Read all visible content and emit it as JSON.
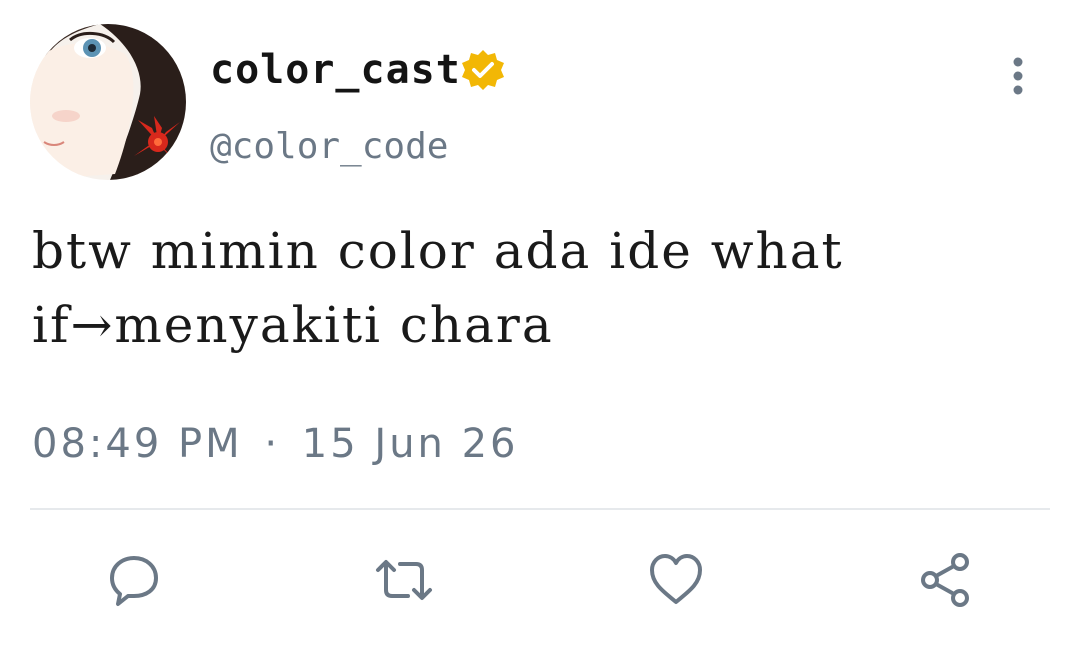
{
  "tweet": {
    "display_name": "color_cast",
    "handle": "@color_code",
    "verified": true,
    "text_lines": [
      "btw mimin color ada ide what",
      "if→menyakiti chara"
    ],
    "time": "08:49 PM",
    "separator": "·",
    "date": "15 Jun 26"
  },
  "icons": {
    "avatar": "anime-avatar",
    "verified": "verified-badge-icon",
    "more": "more-vertical-icon",
    "reply": "reply-icon",
    "retweet": "retweet-icon",
    "like": "heart-icon",
    "share": "share-icon"
  },
  "colors": {
    "verified_badge": "#f2b705",
    "secondary_text": "#6b7886",
    "icon": "#6b7886",
    "divider": "#e6e9ec"
  }
}
